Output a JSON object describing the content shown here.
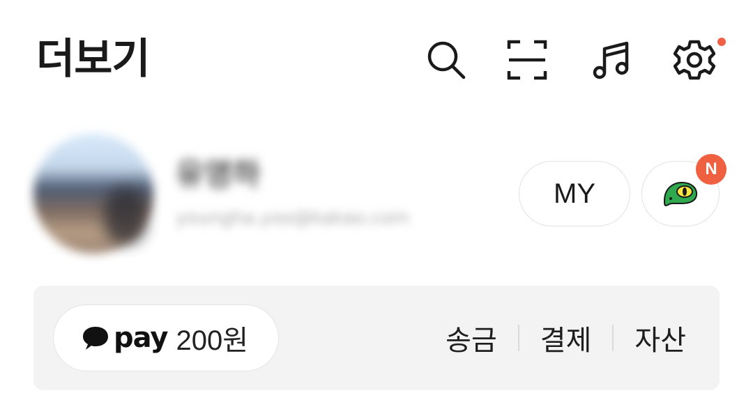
{
  "header": {
    "title": "더보기",
    "icons": [
      "search-icon",
      "scan-icon",
      "music-icon",
      "settings-icon"
    ],
    "settings_has_dot": true
  },
  "profile": {
    "name": "유영하",
    "email": "youngha.yoo@kakao.com",
    "my_label": "MY",
    "emoticon_badge": "N"
  },
  "pay": {
    "logo": "pay",
    "amount": "200원",
    "links": [
      "송금",
      "결제",
      "자산"
    ]
  },
  "colors": {
    "badge": "#ef6040",
    "pay_bar_bg": "#f3f3f3",
    "emoticon_green": "#2fa84f"
  }
}
